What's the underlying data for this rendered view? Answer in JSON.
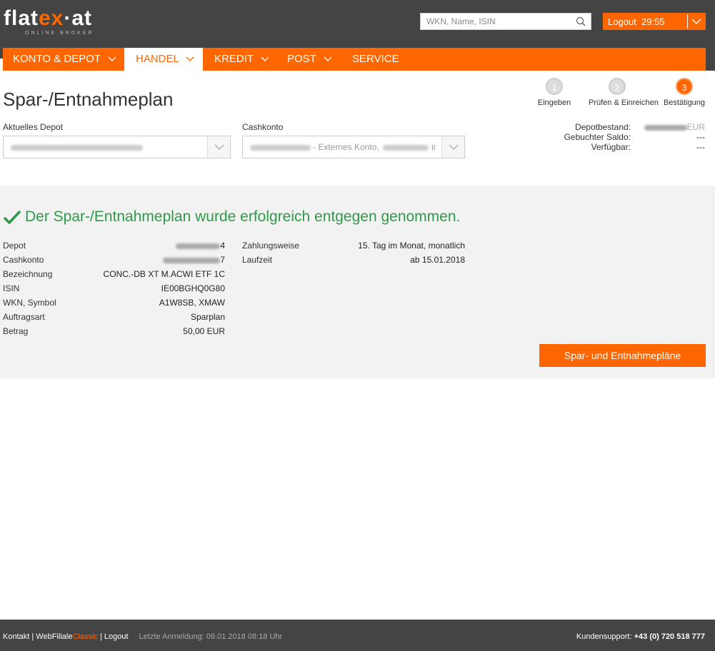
{
  "brand": {
    "logo_text_1": "flat",
    "logo_text_2": "ex",
    "logo_text_3": "·at",
    "logo_sub": "ONLINE BROKER",
    "accent": "#ff6600",
    "success_color": "#2e9a47"
  },
  "header": {
    "search_placeholder": "WKN, Name, ISIN",
    "logout_label": "Logout",
    "session_timer": "29:55"
  },
  "nav": {
    "items": [
      {
        "label": "KONTO & DEPOT",
        "has_dropdown": true,
        "active": false
      },
      {
        "label": "HANDEL",
        "has_dropdown": true,
        "active": true
      },
      {
        "label": "KREDIT",
        "has_dropdown": true,
        "active": false
      },
      {
        "label": "POST",
        "has_dropdown": true,
        "active": false
      },
      {
        "label": "SERVICE",
        "has_dropdown": false,
        "active": false
      }
    ]
  },
  "page": {
    "title": "Spar-/Entnahmeplan"
  },
  "steps": [
    {
      "num": "1",
      "label": "Eingeben"
    },
    {
      "num": "2",
      "label": "Prüfen & Einreichen"
    },
    {
      "num": "3",
      "label": "Bestätigung"
    }
  ],
  "selectors": {
    "depot_label": "Aktuelles Depot",
    "cash_label": "Cashkonto",
    "cash_value_visible": "- Externes Konto,",
    "cash_value_tail": "ir"
  },
  "balances": {
    "depotbestand_label": "Depotbestand:",
    "depotbestand_value_tail": "EUR",
    "saldo_label": "Gebuchter Saldo:",
    "saldo_value": "---",
    "verfuegbar_label": "Verfügbar:",
    "verfuegbar_value": "---"
  },
  "confirmation": {
    "message": "Der Spar-/Entnahmeplan wurde erfolgreich entgegen genommen.",
    "left": [
      {
        "label": "Depot",
        "value": "",
        "blurred": true,
        "tail": "4"
      },
      {
        "label": "Cashkonto",
        "value": "",
        "blurred": true,
        "tail": "7"
      },
      {
        "label": "Bezeichnung",
        "value": "CONC.-DB XT M.ACWI ETF 1C"
      },
      {
        "label": "ISIN",
        "value": "IE00BGHQ0G80"
      },
      {
        "label": "WKN, Symbol",
        "value": "A1W8SB, XMAW"
      },
      {
        "label": "Auftragsart",
        "value": "Sparplan"
      },
      {
        "label": "Betrag",
        "value": "50,00 EUR"
      }
    ],
    "right": [
      {
        "label": "Zahlungsweise",
        "value": "15. Tag im Monat, monatlich"
      },
      {
        "label": "Laufzeit",
        "value": "ab 15.01.2018"
      }
    ],
    "button_label": "Spar- und Entnahmepläne"
  },
  "footer": {
    "kontakt": "Kontakt",
    "webfiliale": "WebFiliale",
    "classic": "Classic",
    "logout": "Logout",
    "last_login": "Letzte Anmeldung: 09.01.2018 08:18 Uhr",
    "support_label": "Kundensupport:",
    "support_phone": "+43 (0) 720 518 777"
  }
}
